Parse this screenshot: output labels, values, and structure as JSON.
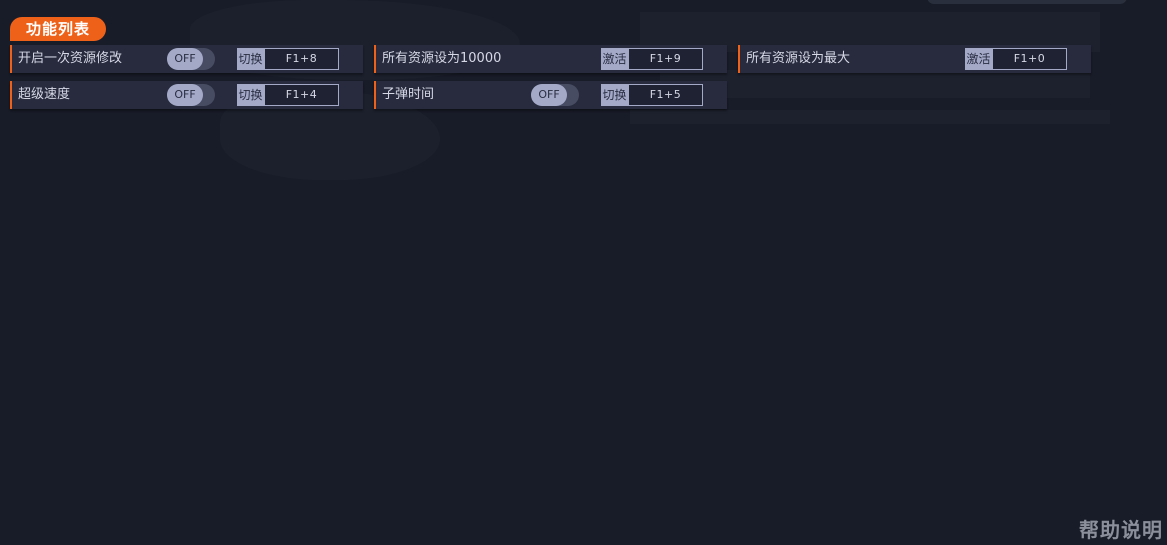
{
  "section": {
    "title": "功能列表"
  },
  "features": [
    {
      "label": "开启一次资源修改",
      "has_toggle": true,
      "toggle_state": "OFF",
      "action": "切换",
      "hotkey": "F1+8"
    },
    {
      "label": "所有资源设为10000",
      "has_toggle": false,
      "action": "激活",
      "hotkey": "F1+9"
    },
    {
      "label": "所有资源设为最大",
      "has_toggle": false,
      "action": "激活",
      "hotkey": "F1+0"
    },
    {
      "label": "超级速度",
      "has_toggle": true,
      "toggle_state": "OFF",
      "action": "切换",
      "hotkey": "F1+4"
    },
    {
      "label": "子弹时间",
      "has_toggle": true,
      "toggle_state": "OFF",
      "action": "切换",
      "hotkey": "F1+5"
    }
  ],
  "help": {
    "label": "帮助说明"
  },
  "colors": {
    "background": "#181c28",
    "accent": "#ee6119",
    "row_bg": "#272b3d",
    "control": "#a4a9c8"
  }
}
